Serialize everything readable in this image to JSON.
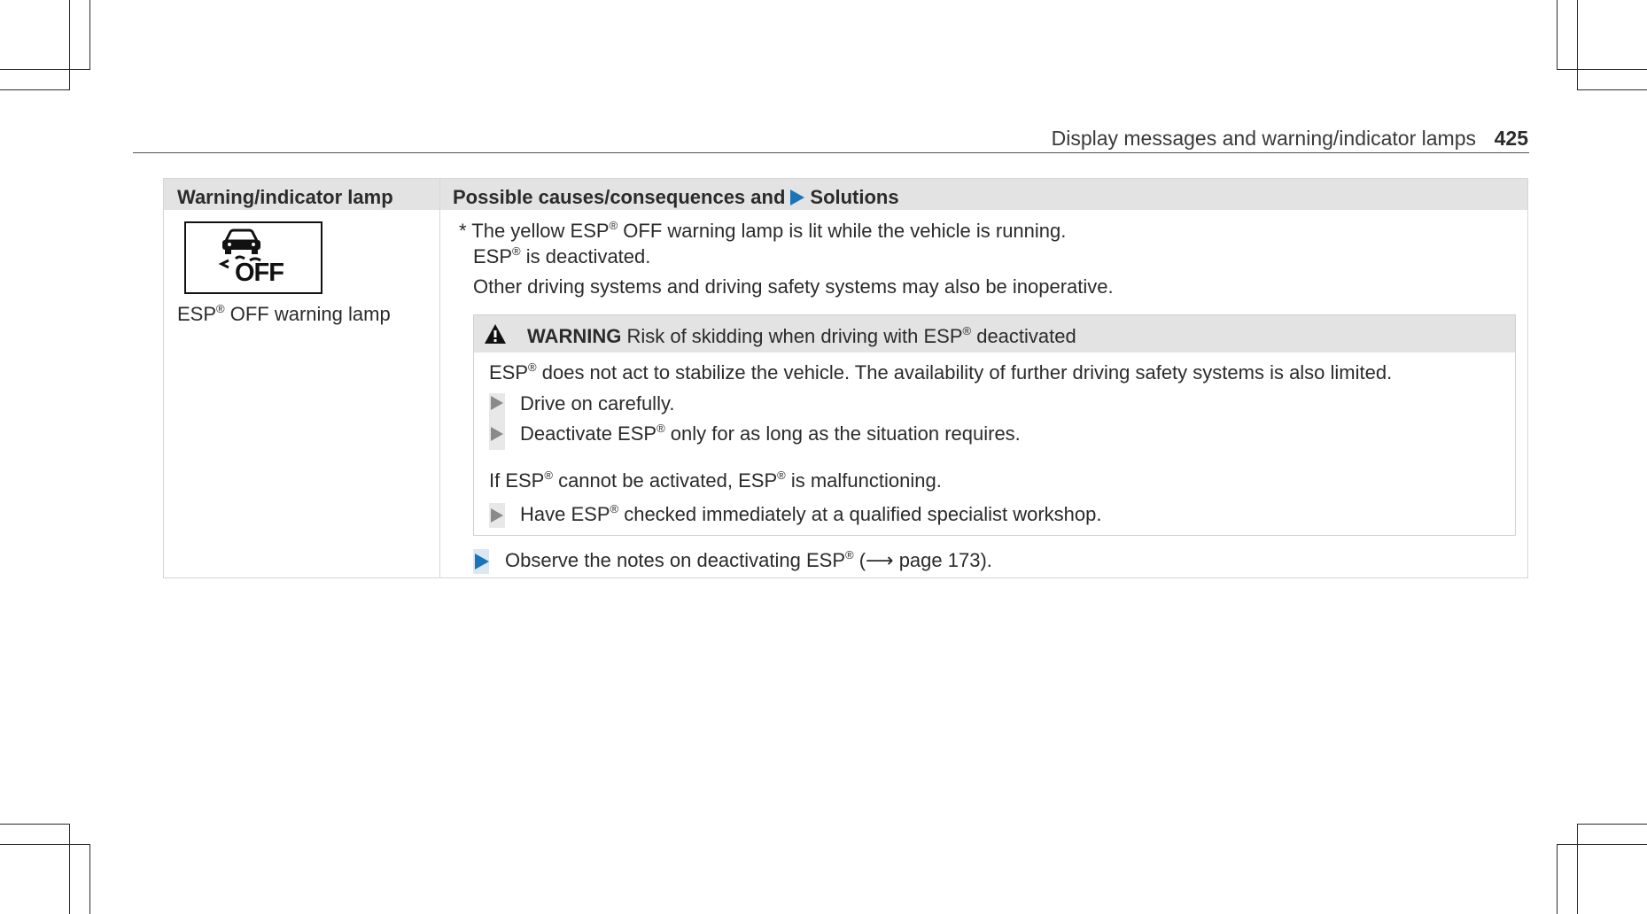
{
  "header": {
    "section_title": "Display messages and warning/indicator lamps",
    "page_number": "425"
  },
  "table": {
    "col1_header": "Warning/indicator lamp",
    "col2_header_prefix": "Possible causes/consequences and",
    "col2_header_suffix": "Solutions",
    "lamp": {
      "icon_text": "OFF",
      "icon_name": "esp-off-icon",
      "caption_pre": "ESP",
      "caption_sup": "®",
      "caption_post": " OFF warning lamp"
    },
    "cause": {
      "line1_a": "* The yellow ESP",
      "line1_sup": "®",
      "line1_b": " OFF warning lamp is lit while the vehicle is running.",
      "line2_a": "ESP",
      "line2_sup": "®",
      "line2_b": " is deactivated.",
      "line3": "Other driving systems and driving safety systems may also be inoperative."
    },
    "warning": {
      "label": "WARNING",
      "title_a": " Risk of skidding when driving with ESP",
      "title_sup": "®",
      "title_b": " deactivated",
      "body_a": "ESP",
      "body_sup": "®",
      "body_b": " does not act to stabilize the vehicle. The availability of further driving safety systems is also limited.",
      "step1": "Drive on carefully.",
      "step2_a": "Deactivate ESP",
      "step2_sup": "®",
      "step2_b": " only for as long as the situation requires.",
      "malf_a": "If ESP",
      "malf_sup1": "®",
      "malf_b": " cannot be activated, ESP",
      "malf_sup2": "®",
      "malf_c": " is malfunctioning.",
      "step3_a": "Have ESP",
      "step3_sup": "®",
      "step3_b": " checked immediately at a qualified specialist workshop."
    },
    "solution": {
      "text_a": "Observe the notes on deactivating ESP",
      "text_sup": "®",
      "text_b": " (⟶ page 173)."
    }
  },
  "colors": {
    "accent_blue": "#1a74b8",
    "header_gray": "#e3e3e3"
  }
}
